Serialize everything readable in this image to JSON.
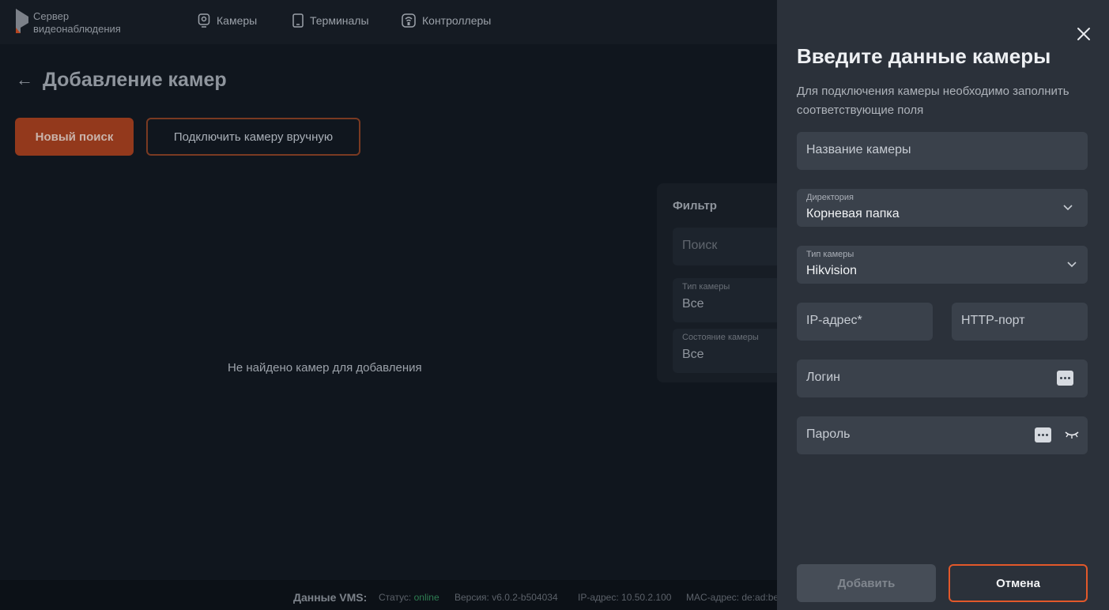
{
  "header": {
    "logo_line1": "Сервер",
    "logo_line2": "видеонаблюдения",
    "nav": [
      {
        "label": "Камеры",
        "icon": "camera-icon"
      },
      {
        "label": "Терминалы",
        "icon": "terminal-icon"
      },
      {
        "label": "Контроллеры",
        "icon": "controller-icon"
      }
    ]
  },
  "page": {
    "title": "Добавление камер",
    "new_search_label": "Новый поиск",
    "manual_connect_label": "Подключить камеру вручную",
    "empty_message": "Не найдено камер для добавления"
  },
  "filter": {
    "title": "Фильтр",
    "search_placeholder": "Поиск",
    "camera_type_label": "Тип камеры",
    "camera_type_value": "Все",
    "camera_state_label": "Состояние камеры",
    "camera_state_value": "Все"
  },
  "footer": {
    "vms_label": "Данные VMS:",
    "status_label": "Статус:",
    "status_value": "online",
    "version": "Версия: v6.0.2-b504034",
    "ip": "IP-адрес: 10.50.2.100",
    "mac": "MAC-адрес: de:ad:be"
  },
  "panel": {
    "title": "Введите данные камеры",
    "description": "Для подключения камеры необходимо заполнить соответствующие поля",
    "camera_name_placeholder": "Название камеры",
    "directory_label": "Директория",
    "directory_value": "Корневая папка",
    "camera_type_label": "Тип камеры",
    "camera_type_value": "Hikvision",
    "ip_placeholder": "IP-адрес*",
    "http_port_placeholder": "HTTP-порт",
    "login_placeholder": "Логин",
    "password_placeholder": "Пароль",
    "add_label": "Добавить",
    "cancel_label": "Отмена"
  },
  "colors": {
    "accent": "#e2582a",
    "online": "#2e7d52",
    "panel_bg": "#2b313a",
    "field_bg": "#3a414b"
  }
}
